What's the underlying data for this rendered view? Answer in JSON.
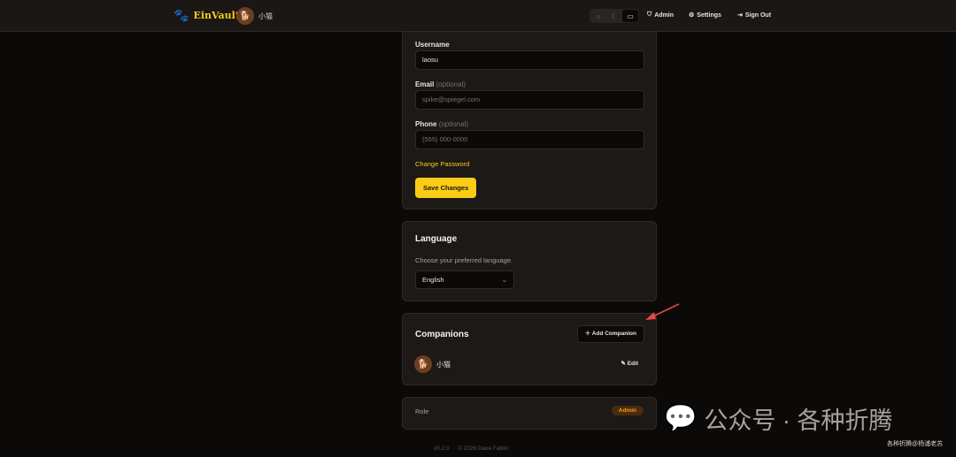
{
  "header": {
    "brand": "EinVault",
    "user": "小猫",
    "nav": {
      "admin": "Admin",
      "settings": "Settings",
      "sign_out": "Sign Out"
    }
  },
  "profile": {
    "username_label": "Username",
    "username_value": "laosu",
    "email_label": "Email",
    "email_hint": "(optional)",
    "email_placeholder": "spike@spiegel.com",
    "phone_label": "Phone",
    "phone_hint": "(optional)",
    "phone_placeholder": "(555) 000-0000",
    "change_password": "Change Password",
    "save": "Save Changes"
  },
  "language": {
    "title": "Language",
    "subtitle": "Choose your preferred language.",
    "selected": "English"
  },
  "companions": {
    "title": "Companions",
    "add": "Add Companion",
    "items": [
      {
        "name": "小猫",
        "edit": "Edit"
      }
    ]
  },
  "role": {
    "label": "Role",
    "value": "Admin"
  },
  "footer": {
    "version": "v0.2.0",
    "sep": "·",
    "copyright": "© 2026 Dave Fatkin"
  },
  "watermark": {
    "main": "公众号 · 各种折腾",
    "sub": "各种折腾@杨浦老苏"
  },
  "colors": {
    "accent": "#facc15",
    "bg": "#0c0a09",
    "card": "#1c1917"
  }
}
